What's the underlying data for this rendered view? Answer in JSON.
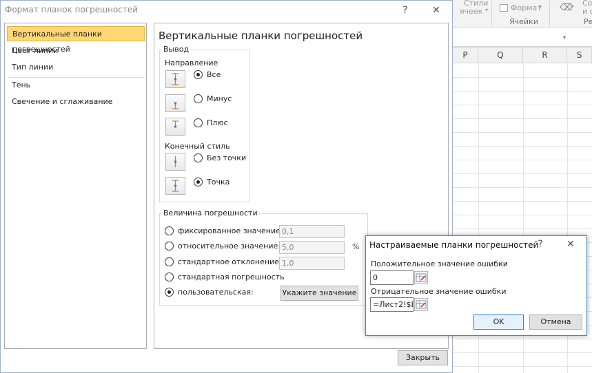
{
  "excel": {
    "ribbon": {
      "styles_line1": "Стили",
      "styles_line2": "ячеек",
      "format_label": "Формат",
      "cells_group": "Ячейки",
      "right_cut_1": "Со",
      "right_cut_2": "и с",
      "right_cut_3": "Ре"
    },
    "columns": [
      "P",
      "Q",
      "R",
      "S"
    ]
  },
  "main_dialog": {
    "title": "Формат планок погрешностей",
    "help_label": "?",
    "close_label": "✕",
    "nav": {
      "items": [
        {
          "label": "Вертикальные планки погрешностей",
          "selected": true
        },
        {
          "label": "Цвет линии",
          "selected": false
        },
        {
          "label": "Тип линии",
          "selected": false
        },
        {
          "label": "Тень",
          "selected": false
        },
        {
          "label": "Свечение и сглаживание",
          "selected": false
        }
      ]
    },
    "panel": {
      "heading": "Вертикальные планки погрешностей",
      "output_group": "Вывод",
      "direction_label": "Направление",
      "direction": [
        {
          "label": "Все",
          "selected": true,
          "icon": "error-bar-both-icon"
        },
        {
          "label": "Минус",
          "selected": false,
          "icon": "error-bar-minus-icon"
        },
        {
          "label": "Плюс",
          "selected": false,
          "icon": "error-bar-plus-icon"
        }
      ],
      "end_style_label": "Конечный стиль",
      "end_style": [
        {
          "label": "Без точки",
          "selected": false,
          "icon": "error-bar-no-cap-icon"
        },
        {
          "label": "Точка",
          "selected": true,
          "icon": "error-bar-cap-icon"
        }
      ],
      "error_amount_group": "Величина погрешности",
      "error_amount": [
        {
          "label": "фиксированное значение:",
          "value": "0,1",
          "selected": false
        },
        {
          "label": "относительное значение:",
          "value": "5,0",
          "unit": "%",
          "selected": false
        },
        {
          "label": "стандартное отклонение:",
          "value": "1,0",
          "selected": false
        },
        {
          "label": "стандартная погрешность",
          "selected": false
        },
        {
          "label": "пользовательская:",
          "selected": true
        }
      ],
      "specify_value_button": "Укажите значение"
    },
    "close_button": "Закрыть"
  },
  "custom_dialog": {
    "title": "Настраиваемые планки погрешностей",
    "help_label": "?",
    "close_label": "✕",
    "positive_label": "Положительное значение ошибки",
    "positive_value": "0",
    "negative_label": "Отрицательное значение ошибки",
    "negative_value": "=Лист2!$B",
    "ok_button": "OK",
    "cancel_button": "Отмена"
  }
}
